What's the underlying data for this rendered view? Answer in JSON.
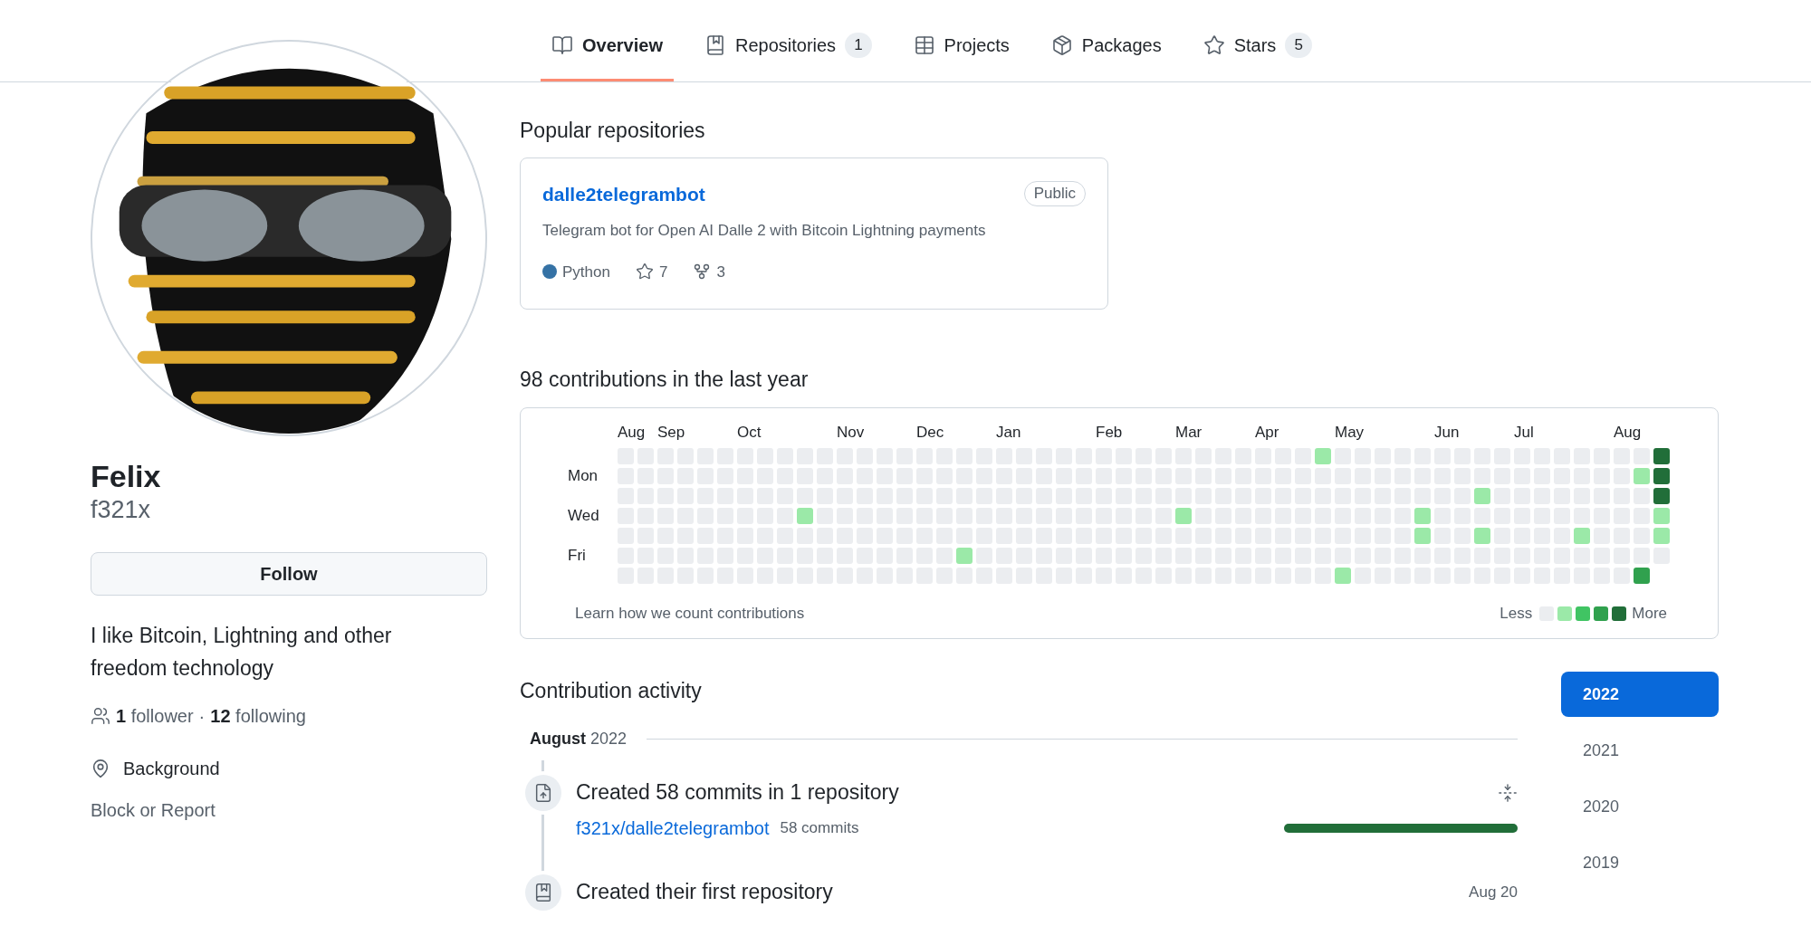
{
  "tabs": [
    {
      "label": "Overview",
      "selected": true
    },
    {
      "label": "Repositories",
      "count": "1",
      "selected": false
    },
    {
      "label": "Projects",
      "selected": false
    },
    {
      "label": "Packages",
      "selected": false
    },
    {
      "label": "Stars",
      "count": "5",
      "selected": false
    }
  ],
  "profile": {
    "name": "Felix",
    "username": "f321x",
    "follow_button": "Follow",
    "bio": "I like Bitcoin, Lightning and other freedom technology",
    "followers": {
      "count": "1",
      "label": "follower"
    },
    "separator": "·",
    "following": {
      "count": "12",
      "label": "following"
    },
    "location": "Background",
    "block_link": "Block or Report"
  },
  "popular": {
    "heading": "Popular repositories",
    "repos": [
      {
        "name": "dalle2telegrambot",
        "visibility": "Public",
        "description": "Telegram bot for Open AI Dalle 2 with Bitcoin Lightning payments",
        "language": "Python",
        "color": "#3572a5",
        "stars": "7",
        "forks": "3"
      }
    ]
  },
  "contributions": {
    "heading": "98 contributions in the last year",
    "day_labels": [
      "Mon",
      "Wed",
      "Fri"
    ],
    "weeks": [
      {
        "month": "Aug",
        "days": [
          {
            "color": "#ebedf0"
          },
          {
            "color": "#ebedf0"
          },
          {
            "color": "#ebedf0"
          },
          {
            "color": "#ebedf0"
          },
          {
            "color": "#ebedf0"
          },
          {
            "color": "#ebedf0"
          },
          {
            "color": "#ebedf0"
          }
        ]
      },
      {
        "days": [
          {
            "color": "#ebedf0"
          },
          {
            "color": "#ebedf0"
          },
          {
            "color": "#ebedf0"
          },
          {
            "color": "#ebedf0"
          },
          {
            "color": "#ebedf0"
          },
          {
            "color": "#ebedf0"
          },
          {
            "color": "#ebedf0"
          }
        ]
      },
      {
        "month": "Sep",
        "days": [
          {
            "color": "#ebedf0"
          },
          {
            "color": "#ebedf0"
          },
          {
            "color": "#ebedf0"
          },
          {
            "color": "#ebedf0"
          },
          {
            "color": "#ebedf0"
          },
          {
            "color": "#ebedf0"
          },
          {
            "color": "#ebedf0"
          }
        ]
      },
      {
        "days": [
          {
            "color": "#ebedf0"
          },
          {
            "color": "#ebedf0"
          },
          {
            "color": "#ebedf0"
          },
          {
            "color": "#ebedf0"
          },
          {
            "color": "#ebedf0"
          },
          {
            "color": "#ebedf0"
          },
          {
            "color": "#ebedf0"
          }
        ]
      },
      {
        "days": [
          {
            "color": "#ebedf0"
          },
          {
            "color": "#ebedf0"
          },
          {
            "color": "#ebedf0"
          },
          {
            "color": "#ebedf0"
          },
          {
            "color": "#ebedf0"
          },
          {
            "color": "#ebedf0"
          },
          {
            "color": "#ebedf0"
          }
        ]
      },
      {
        "days": [
          {
            "color": "#ebedf0"
          },
          {
            "color": "#ebedf0"
          },
          {
            "color": "#ebedf0"
          },
          {
            "color": "#ebedf0"
          },
          {
            "color": "#ebedf0"
          },
          {
            "color": "#ebedf0"
          },
          {
            "color": "#ebedf0"
          }
        ]
      },
      {
        "month": "Oct",
        "days": [
          {
            "color": "#ebedf0"
          },
          {
            "color": "#ebedf0"
          },
          {
            "color": "#ebedf0"
          },
          {
            "color": "#ebedf0"
          },
          {
            "color": "#ebedf0"
          },
          {
            "color": "#ebedf0"
          },
          {
            "color": "#ebedf0"
          }
        ]
      },
      {
        "days": [
          {
            "color": "#ebedf0"
          },
          {
            "color": "#ebedf0"
          },
          {
            "color": "#ebedf0"
          },
          {
            "color": "#ebedf0"
          },
          {
            "color": "#ebedf0"
          },
          {
            "color": "#ebedf0"
          },
          {
            "color": "#ebedf0"
          }
        ]
      },
      {
        "days": [
          {
            "color": "#ebedf0"
          },
          {
            "color": "#ebedf0"
          },
          {
            "color": "#ebedf0"
          },
          {
            "color": "#ebedf0"
          },
          {
            "color": "#ebedf0"
          },
          {
            "color": "#ebedf0"
          },
          {
            "color": "#ebedf0"
          }
        ]
      },
      {
        "days": [
          {
            "color": "#ebedf0"
          },
          {
            "color": "#ebedf0"
          },
          {
            "color": "#ebedf0"
          },
          {
            "color": "#9be9a8"
          },
          {
            "color": "#ebedf0"
          },
          {
            "color": "#ebedf0"
          },
          {
            "color": "#ebedf0"
          }
        ]
      },
      {
        "days": [
          {
            "color": "#ebedf0"
          },
          {
            "color": "#ebedf0"
          },
          {
            "color": "#ebedf0"
          },
          {
            "color": "#ebedf0"
          },
          {
            "color": "#ebedf0"
          },
          {
            "color": "#ebedf0"
          },
          {
            "color": "#ebedf0"
          }
        ]
      },
      {
        "month": "Nov",
        "days": [
          {
            "color": "#ebedf0"
          },
          {
            "color": "#ebedf0"
          },
          {
            "color": "#ebedf0"
          },
          {
            "color": "#ebedf0"
          },
          {
            "color": "#ebedf0"
          },
          {
            "color": "#ebedf0"
          },
          {
            "color": "#ebedf0"
          }
        ]
      },
      {
        "days": [
          {
            "color": "#ebedf0"
          },
          {
            "color": "#ebedf0"
          },
          {
            "color": "#ebedf0"
          },
          {
            "color": "#ebedf0"
          },
          {
            "color": "#ebedf0"
          },
          {
            "color": "#ebedf0"
          },
          {
            "color": "#ebedf0"
          }
        ]
      },
      {
        "days": [
          {
            "color": "#ebedf0"
          },
          {
            "color": "#ebedf0"
          },
          {
            "color": "#ebedf0"
          },
          {
            "color": "#ebedf0"
          },
          {
            "color": "#ebedf0"
          },
          {
            "color": "#ebedf0"
          },
          {
            "color": "#ebedf0"
          }
        ]
      },
      {
        "days": [
          {
            "color": "#ebedf0"
          },
          {
            "color": "#ebedf0"
          },
          {
            "color": "#ebedf0"
          },
          {
            "color": "#ebedf0"
          },
          {
            "color": "#ebedf0"
          },
          {
            "color": "#ebedf0"
          },
          {
            "color": "#ebedf0"
          }
        ]
      },
      {
        "month": "Dec",
        "days": [
          {
            "color": "#ebedf0"
          },
          {
            "color": "#ebedf0"
          },
          {
            "color": "#ebedf0"
          },
          {
            "color": "#ebedf0"
          },
          {
            "color": "#ebedf0"
          },
          {
            "color": "#ebedf0"
          },
          {
            "color": "#ebedf0"
          }
        ]
      },
      {
        "days": [
          {
            "color": "#ebedf0"
          },
          {
            "color": "#ebedf0"
          },
          {
            "color": "#ebedf0"
          },
          {
            "color": "#ebedf0"
          },
          {
            "color": "#ebedf0"
          },
          {
            "color": "#ebedf0"
          },
          {
            "color": "#ebedf0"
          }
        ]
      },
      {
        "days": [
          {
            "color": "#ebedf0"
          },
          {
            "color": "#ebedf0"
          },
          {
            "color": "#ebedf0"
          },
          {
            "color": "#ebedf0"
          },
          {
            "color": "#ebedf0"
          },
          {
            "color": "#9be9a8"
          },
          {
            "color": "#ebedf0"
          }
        ]
      },
      {
        "days": [
          {
            "color": "#ebedf0"
          },
          {
            "color": "#ebedf0"
          },
          {
            "color": "#ebedf0"
          },
          {
            "color": "#ebedf0"
          },
          {
            "color": "#ebedf0"
          },
          {
            "color": "#ebedf0"
          },
          {
            "color": "#ebedf0"
          }
        ]
      },
      {
        "month": "Jan",
        "days": [
          {
            "color": "#ebedf0"
          },
          {
            "color": "#ebedf0"
          },
          {
            "color": "#ebedf0"
          },
          {
            "color": "#ebedf0"
          },
          {
            "color": "#ebedf0"
          },
          {
            "color": "#ebedf0"
          },
          {
            "color": "#ebedf0"
          }
        ]
      },
      {
        "days": [
          {
            "color": "#ebedf0"
          },
          {
            "color": "#ebedf0"
          },
          {
            "color": "#ebedf0"
          },
          {
            "color": "#ebedf0"
          },
          {
            "color": "#ebedf0"
          },
          {
            "color": "#ebedf0"
          },
          {
            "color": "#ebedf0"
          }
        ]
      },
      {
        "days": [
          {
            "color": "#ebedf0"
          },
          {
            "color": "#ebedf0"
          },
          {
            "color": "#ebedf0"
          },
          {
            "color": "#ebedf0"
          },
          {
            "color": "#ebedf0"
          },
          {
            "color": "#ebedf0"
          },
          {
            "color": "#ebedf0"
          }
        ]
      },
      {
        "days": [
          {
            "color": "#ebedf0"
          },
          {
            "color": "#ebedf0"
          },
          {
            "color": "#ebedf0"
          },
          {
            "color": "#ebedf0"
          },
          {
            "color": "#ebedf0"
          },
          {
            "color": "#ebedf0"
          },
          {
            "color": "#ebedf0"
          }
        ]
      },
      {
        "days": [
          {
            "color": "#ebedf0"
          },
          {
            "color": "#ebedf0"
          },
          {
            "color": "#ebedf0"
          },
          {
            "color": "#ebedf0"
          },
          {
            "color": "#ebedf0"
          },
          {
            "color": "#ebedf0"
          },
          {
            "color": "#ebedf0"
          }
        ]
      },
      {
        "month": "Feb",
        "days": [
          {
            "color": "#ebedf0"
          },
          {
            "color": "#ebedf0"
          },
          {
            "color": "#ebedf0"
          },
          {
            "color": "#ebedf0"
          },
          {
            "color": "#ebedf0"
          },
          {
            "color": "#ebedf0"
          },
          {
            "color": "#ebedf0"
          }
        ]
      },
      {
        "days": [
          {
            "color": "#ebedf0"
          },
          {
            "color": "#ebedf0"
          },
          {
            "color": "#ebedf0"
          },
          {
            "color": "#ebedf0"
          },
          {
            "color": "#ebedf0"
          },
          {
            "color": "#ebedf0"
          },
          {
            "color": "#ebedf0"
          }
        ]
      },
      {
        "days": [
          {
            "color": "#ebedf0"
          },
          {
            "color": "#ebedf0"
          },
          {
            "color": "#ebedf0"
          },
          {
            "color": "#ebedf0"
          },
          {
            "color": "#ebedf0"
          },
          {
            "color": "#ebedf0"
          },
          {
            "color": "#ebedf0"
          }
        ]
      },
      {
        "days": [
          {
            "color": "#ebedf0"
          },
          {
            "color": "#ebedf0"
          },
          {
            "color": "#ebedf0"
          },
          {
            "color": "#ebedf0"
          },
          {
            "color": "#ebedf0"
          },
          {
            "color": "#ebedf0"
          },
          {
            "color": "#ebedf0"
          }
        ]
      },
      {
        "month": "Mar",
        "days": [
          {
            "color": "#ebedf0"
          },
          {
            "color": "#ebedf0"
          },
          {
            "color": "#ebedf0"
          },
          {
            "color": "#9be9a8"
          },
          {
            "color": "#ebedf0"
          },
          {
            "color": "#ebedf0"
          },
          {
            "color": "#ebedf0"
          }
        ]
      },
      {
        "days": [
          {
            "color": "#ebedf0"
          },
          {
            "color": "#ebedf0"
          },
          {
            "color": "#ebedf0"
          },
          {
            "color": "#ebedf0"
          },
          {
            "color": "#ebedf0"
          },
          {
            "color": "#ebedf0"
          },
          {
            "color": "#ebedf0"
          }
        ]
      },
      {
        "days": [
          {
            "color": "#ebedf0"
          },
          {
            "color": "#ebedf0"
          },
          {
            "color": "#ebedf0"
          },
          {
            "color": "#ebedf0"
          },
          {
            "color": "#ebedf0"
          },
          {
            "color": "#ebedf0"
          },
          {
            "color": "#ebedf0"
          }
        ]
      },
      {
        "days": [
          {
            "color": "#ebedf0"
          },
          {
            "color": "#ebedf0"
          },
          {
            "color": "#ebedf0"
          },
          {
            "color": "#ebedf0"
          },
          {
            "color": "#ebedf0"
          },
          {
            "color": "#ebedf0"
          },
          {
            "color": "#ebedf0"
          }
        ]
      },
      {
        "month": "Apr",
        "days": [
          {
            "color": "#ebedf0"
          },
          {
            "color": "#ebedf0"
          },
          {
            "color": "#ebedf0"
          },
          {
            "color": "#ebedf0"
          },
          {
            "color": "#ebedf0"
          },
          {
            "color": "#ebedf0"
          },
          {
            "color": "#ebedf0"
          }
        ]
      },
      {
        "days": [
          {
            "color": "#ebedf0"
          },
          {
            "color": "#ebedf0"
          },
          {
            "color": "#ebedf0"
          },
          {
            "color": "#ebedf0"
          },
          {
            "color": "#ebedf0"
          },
          {
            "color": "#ebedf0"
          },
          {
            "color": "#ebedf0"
          }
        ]
      },
      {
        "days": [
          {
            "color": "#ebedf0"
          },
          {
            "color": "#ebedf0"
          },
          {
            "color": "#ebedf0"
          },
          {
            "color": "#ebedf0"
          },
          {
            "color": "#ebedf0"
          },
          {
            "color": "#ebedf0"
          },
          {
            "color": "#ebedf0"
          }
        ]
      },
      {
        "days": [
          {
            "color": "#9be9a8"
          },
          {
            "color": "#ebedf0"
          },
          {
            "color": "#ebedf0"
          },
          {
            "color": "#ebedf0"
          },
          {
            "color": "#ebedf0"
          },
          {
            "color": "#ebedf0"
          },
          {
            "color": "#ebedf0"
          }
        ]
      },
      {
        "month": "May",
        "days": [
          {
            "color": "#ebedf0"
          },
          {
            "color": "#ebedf0"
          },
          {
            "color": "#ebedf0"
          },
          {
            "color": "#ebedf0"
          },
          {
            "color": "#ebedf0"
          },
          {
            "color": "#ebedf0"
          },
          {
            "color": "#9be9a8"
          }
        ]
      },
      {
        "days": [
          {
            "color": "#ebedf0"
          },
          {
            "color": "#ebedf0"
          },
          {
            "color": "#ebedf0"
          },
          {
            "color": "#ebedf0"
          },
          {
            "color": "#ebedf0"
          },
          {
            "color": "#ebedf0"
          },
          {
            "color": "#ebedf0"
          }
        ]
      },
      {
        "days": [
          {
            "color": "#ebedf0"
          },
          {
            "color": "#ebedf0"
          },
          {
            "color": "#ebedf0"
          },
          {
            "color": "#ebedf0"
          },
          {
            "color": "#ebedf0"
          },
          {
            "color": "#ebedf0"
          },
          {
            "color": "#ebedf0"
          }
        ]
      },
      {
        "days": [
          {
            "color": "#ebedf0"
          },
          {
            "color": "#ebedf0"
          },
          {
            "color": "#ebedf0"
          },
          {
            "color": "#ebedf0"
          },
          {
            "color": "#ebedf0"
          },
          {
            "color": "#ebedf0"
          },
          {
            "color": "#ebedf0"
          }
        ]
      },
      {
        "days": [
          {
            "color": "#ebedf0"
          },
          {
            "color": "#ebedf0"
          },
          {
            "color": "#ebedf0"
          },
          {
            "color": "#9be9a8"
          },
          {
            "color": "#9be9a8"
          },
          {
            "color": "#ebedf0"
          },
          {
            "color": "#ebedf0"
          }
        ]
      },
      {
        "month": "Jun",
        "days": [
          {
            "color": "#ebedf0"
          },
          {
            "color": "#ebedf0"
          },
          {
            "color": "#ebedf0"
          },
          {
            "color": "#ebedf0"
          },
          {
            "color": "#ebedf0"
          },
          {
            "color": "#ebedf0"
          },
          {
            "color": "#ebedf0"
          }
        ]
      },
      {
        "days": [
          {
            "color": "#ebedf0"
          },
          {
            "color": "#ebedf0"
          },
          {
            "color": "#ebedf0"
          },
          {
            "color": "#ebedf0"
          },
          {
            "color": "#ebedf0"
          },
          {
            "color": "#ebedf0"
          },
          {
            "color": "#ebedf0"
          }
        ]
      },
      {
        "days": [
          {
            "color": "#ebedf0"
          },
          {
            "color": "#ebedf0"
          },
          {
            "color": "#9be9a8"
          },
          {
            "color": "#ebedf0"
          },
          {
            "color": "#9be9a8"
          },
          {
            "color": "#ebedf0"
          },
          {
            "color": "#ebedf0"
          }
        ]
      },
      {
        "days": [
          {
            "color": "#ebedf0"
          },
          {
            "color": "#ebedf0"
          },
          {
            "color": "#ebedf0"
          },
          {
            "color": "#ebedf0"
          },
          {
            "color": "#ebedf0"
          },
          {
            "color": "#ebedf0"
          },
          {
            "color": "#ebedf0"
          }
        ]
      },
      {
        "month": "Jul",
        "days": [
          {
            "color": "#ebedf0"
          },
          {
            "color": "#ebedf0"
          },
          {
            "color": "#ebedf0"
          },
          {
            "color": "#ebedf0"
          },
          {
            "color": "#ebedf0"
          },
          {
            "color": "#ebedf0"
          },
          {
            "color": "#ebedf0"
          }
        ]
      },
      {
        "days": [
          {
            "color": "#ebedf0"
          },
          {
            "color": "#ebedf0"
          },
          {
            "color": "#ebedf0"
          },
          {
            "color": "#ebedf0"
          },
          {
            "color": "#ebedf0"
          },
          {
            "color": "#ebedf0"
          },
          {
            "color": "#ebedf0"
          }
        ]
      },
      {
        "days": [
          {
            "color": "#ebedf0"
          },
          {
            "color": "#ebedf0"
          },
          {
            "color": "#ebedf0"
          },
          {
            "color": "#ebedf0"
          },
          {
            "color": "#ebedf0"
          },
          {
            "color": "#ebedf0"
          },
          {
            "color": "#ebedf0"
          }
        ]
      },
      {
        "days": [
          {
            "color": "#ebedf0"
          },
          {
            "color": "#ebedf0"
          },
          {
            "color": "#ebedf0"
          },
          {
            "color": "#ebedf0"
          },
          {
            "color": "#9be9a8"
          },
          {
            "color": "#ebedf0"
          },
          {
            "color": "#ebedf0"
          }
        ]
      },
      {
        "days": [
          {
            "color": "#ebedf0"
          },
          {
            "color": "#ebedf0"
          },
          {
            "color": "#ebedf0"
          },
          {
            "color": "#ebedf0"
          },
          {
            "color": "#ebedf0"
          },
          {
            "color": "#ebedf0"
          },
          {
            "color": "#ebedf0"
          }
        ]
      },
      {
        "month": "Aug",
        "days": [
          {
            "color": "#ebedf0"
          },
          {
            "color": "#ebedf0"
          },
          {
            "color": "#ebedf0"
          },
          {
            "color": "#ebedf0"
          },
          {
            "color": "#ebedf0"
          },
          {
            "color": "#ebedf0"
          },
          {
            "color": "#ebedf0"
          }
        ]
      },
      {
        "days": [
          {
            "color": "#ebedf0"
          },
          {
            "color": "#9be9a8"
          },
          {
            "color": "#ebedf0"
          },
          {
            "color": "#ebedf0"
          },
          {
            "color": "#ebedf0"
          },
          {
            "color": "#ebedf0"
          },
          {
            "color": "#30a14e"
          }
        ]
      },
      {
        "days": [
          {
            "color": "#216e39"
          },
          {
            "color": "#216e39"
          },
          {
            "color": "#216e39"
          },
          {
            "color": "#9be9a8"
          },
          {
            "color": "#9be9a8"
          },
          {
            "color": "#ebedf0"
          }
        ]
      }
    ],
    "learn_link": "Learn how we count contributions",
    "legend_less": "Less",
    "legend_more": "More"
  },
  "activity": {
    "heading": "Contribution activity",
    "month": "August",
    "year": "2022",
    "years": [
      {
        "label": "2022",
        "selected": true
      },
      {
        "label": "2021",
        "selected": false
      },
      {
        "label": "2020",
        "selected": false
      },
      {
        "label": "2019",
        "selected": false
      }
    ],
    "events": [
      {
        "kind": "commits",
        "title": "Created 58 commits in 1 repository",
        "repo": "f321x/dalle2telegrambot",
        "commits": "58 commits",
        "level": 1
      },
      {
        "kind": "repo_created",
        "title": "Created their first repository",
        "date": "Aug 20"
      }
    ]
  }
}
